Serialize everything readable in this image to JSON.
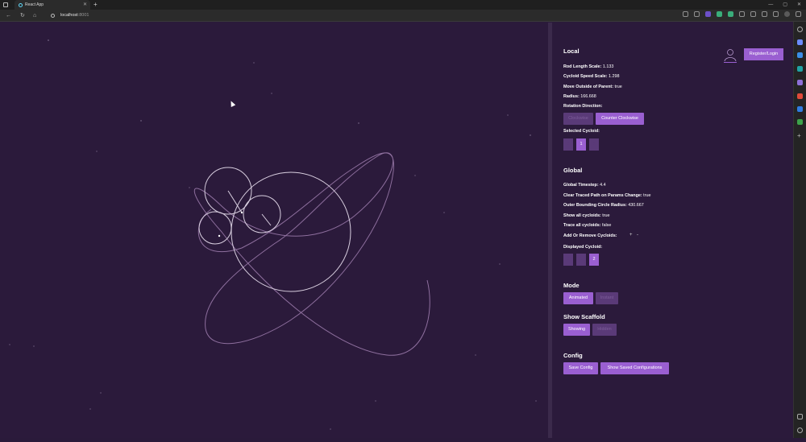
{
  "browser": {
    "tab_title": "React App",
    "new_tab_label": "+",
    "close_tab_label": "✕",
    "url_host": "localhost",
    "url_port": ":8001",
    "window_buttons": [
      "—",
      "▢",
      "✕"
    ],
    "back_label": "←",
    "reload_label": "↻",
    "home_label": "⌂"
  },
  "panel": {
    "register_label": "Register/Login",
    "local": {
      "title": "Local",
      "rod_length_scale_label": "Rod Length Scale:",
      "rod_length_scale_value": "1.133",
      "cycloid_speed_scale_label": "Cycloid Speed Scale:",
      "cycloid_speed_scale_value": "1.298",
      "move_outside_label": "Move Outside of Parent:",
      "move_outside_value": "true",
      "radius_label": "Radius:",
      "radius_value": "166.668",
      "rotation_direction_label": "Rotation Direction:",
      "clockwise_label": "Clockwise",
      "counter_clockwise_label": "Counter Clockwise",
      "selected_cycloid_label": "Selected Cycloid:",
      "selected_cycloid_options": [
        "0",
        "1",
        "2"
      ]
    },
    "global": {
      "title": "Global",
      "timestep_label": "Global Timestep:",
      "timestep_value": "4.4",
      "clear_traced_label": "Clear Traced Path on Params Change:",
      "clear_traced_value": "true",
      "outer_radius_label": "Outer Bounding Circle Radius:",
      "outer_radius_value": "430.667",
      "show_all_label": "Show all cycloids:",
      "show_all_value": "true",
      "trace_all_label": "Trace all cycloids:",
      "trace_all_value": "false",
      "add_remove_label": "Add Or Remove Cycloids:",
      "add_label": "+",
      "remove_label": "-",
      "displayed_cycloid_label": "Displayed Cycloid:",
      "displayed_cycloid_options": [
        "0",
        "1",
        "2"
      ]
    },
    "mode": {
      "title": "Mode",
      "animated_label": "Animated",
      "instant_label": "Instant"
    },
    "scaffold": {
      "title": "Show Scaffold",
      "showing_label": "Showing",
      "hidden_label": "Hidden"
    },
    "config": {
      "title": "Config",
      "save_label": "Save Config",
      "show_saved_label": "Show Saved Configurations"
    }
  },
  "colors": {
    "background": "#2b1a3b",
    "accent": "#9a5fd1",
    "accent_dim": "#5a3a78",
    "trace": "#8e6f9e",
    "circle": "#d9cfe0"
  }
}
